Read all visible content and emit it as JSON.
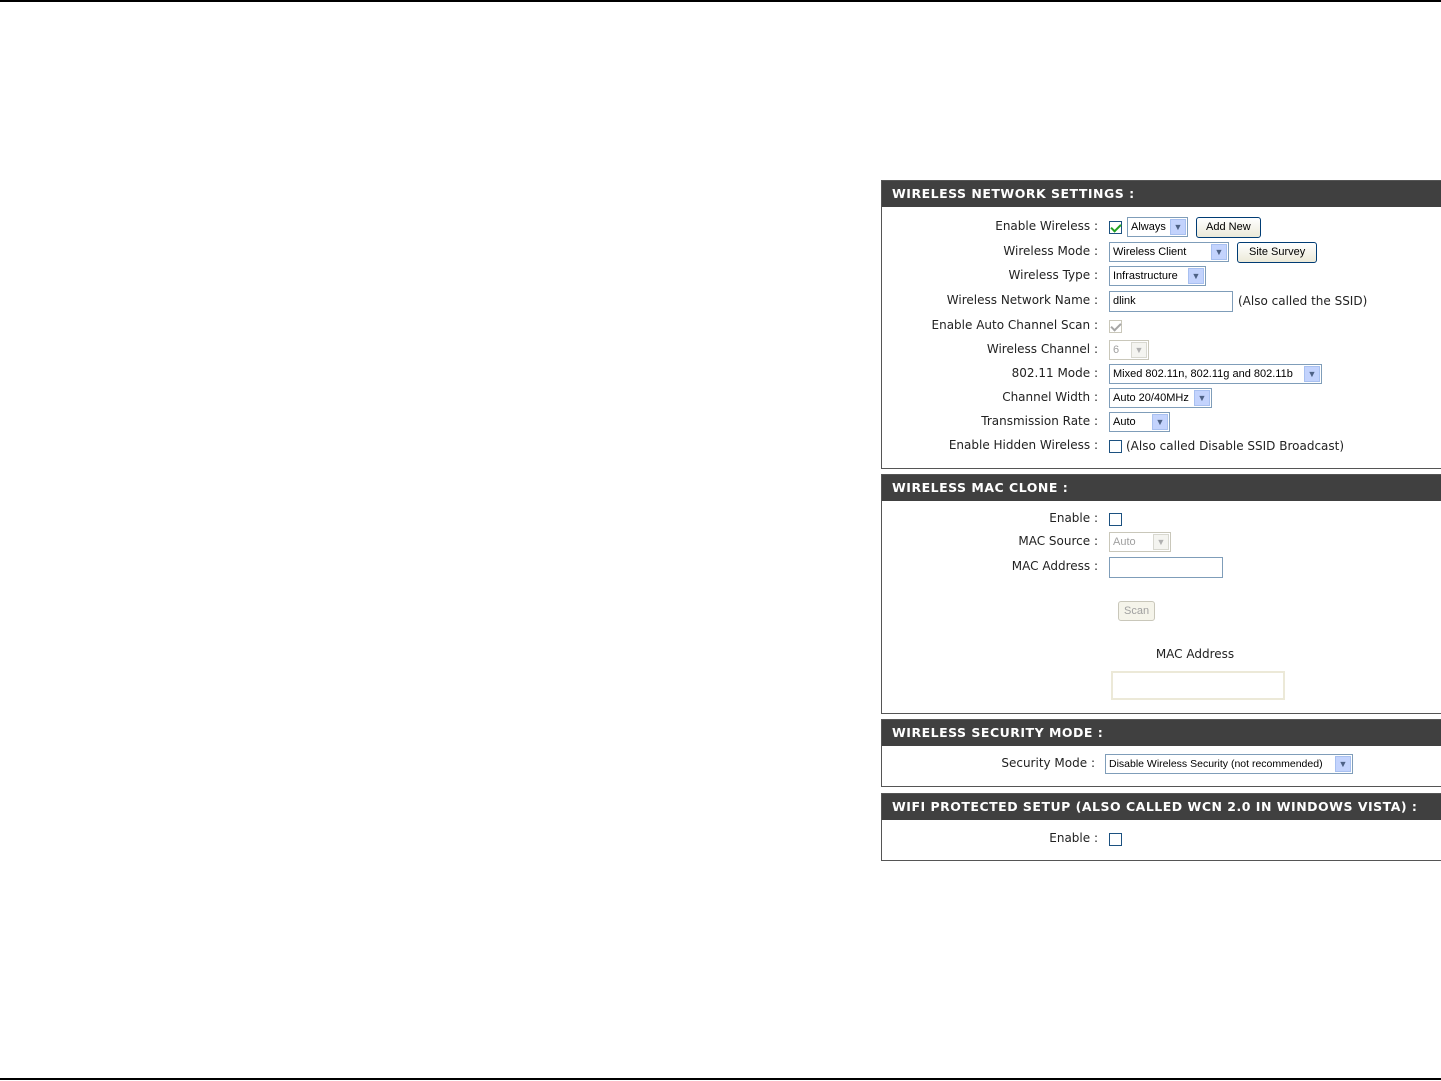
{
  "wireless_network_settings": {
    "title": "WIRELESS NETWORK SETTINGS :",
    "enable_wireless": {
      "label": "Enable Wireless :",
      "checked": true,
      "schedule": "Always",
      "add_new": "Add New"
    },
    "wireless_mode": {
      "label": "Wireless Mode :",
      "value": "Wireless Client",
      "site_survey": "Site Survey"
    },
    "wireless_type": {
      "label": "Wireless Type :",
      "value": "Infrastructure"
    },
    "network_name": {
      "label": "Wireless Network Name :",
      "value": "dlink",
      "note": "(Also called the SSID)"
    },
    "auto_channel": {
      "label": "Enable Auto Channel Scan :",
      "checked": true
    },
    "channel": {
      "label": "Wireless Channel :",
      "value": "6"
    },
    "mode_80211": {
      "label": "802.11 Mode :",
      "value": "Mixed 802.11n, 802.11g and 802.11b"
    },
    "channel_width": {
      "label": "Channel Width :",
      "value": "Auto 20/40MHz"
    },
    "transmission_rate": {
      "label": "Transmission Rate :",
      "value": "Auto"
    },
    "hidden_wireless": {
      "label": "Enable Hidden Wireless :",
      "checked": false,
      "note": "(Also called Disable SSID Broadcast)"
    }
  },
  "wireless_mac_clone": {
    "title": "WIRELESS MAC CLONE :",
    "enable": {
      "label": "Enable :",
      "checked": false
    },
    "mac_source": {
      "label": "MAC Source :",
      "value": "Auto"
    },
    "mac_address": {
      "label": "MAC Address :",
      "value": ""
    },
    "scan": "Scan",
    "list_header": "MAC Address"
  },
  "wireless_security_mode": {
    "title": "WIRELESS SECURITY MODE :",
    "security_mode": {
      "label": "Security Mode :",
      "value": "Disable Wireless Security (not recommended)"
    }
  },
  "wifi_protected_setup": {
    "title": "WIFI PROTECTED SETUP (ALSO CALLED WCN 2.0 IN WINDOWS VISTA) :",
    "enable": {
      "label": "Enable :",
      "checked": false
    }
  }
}
